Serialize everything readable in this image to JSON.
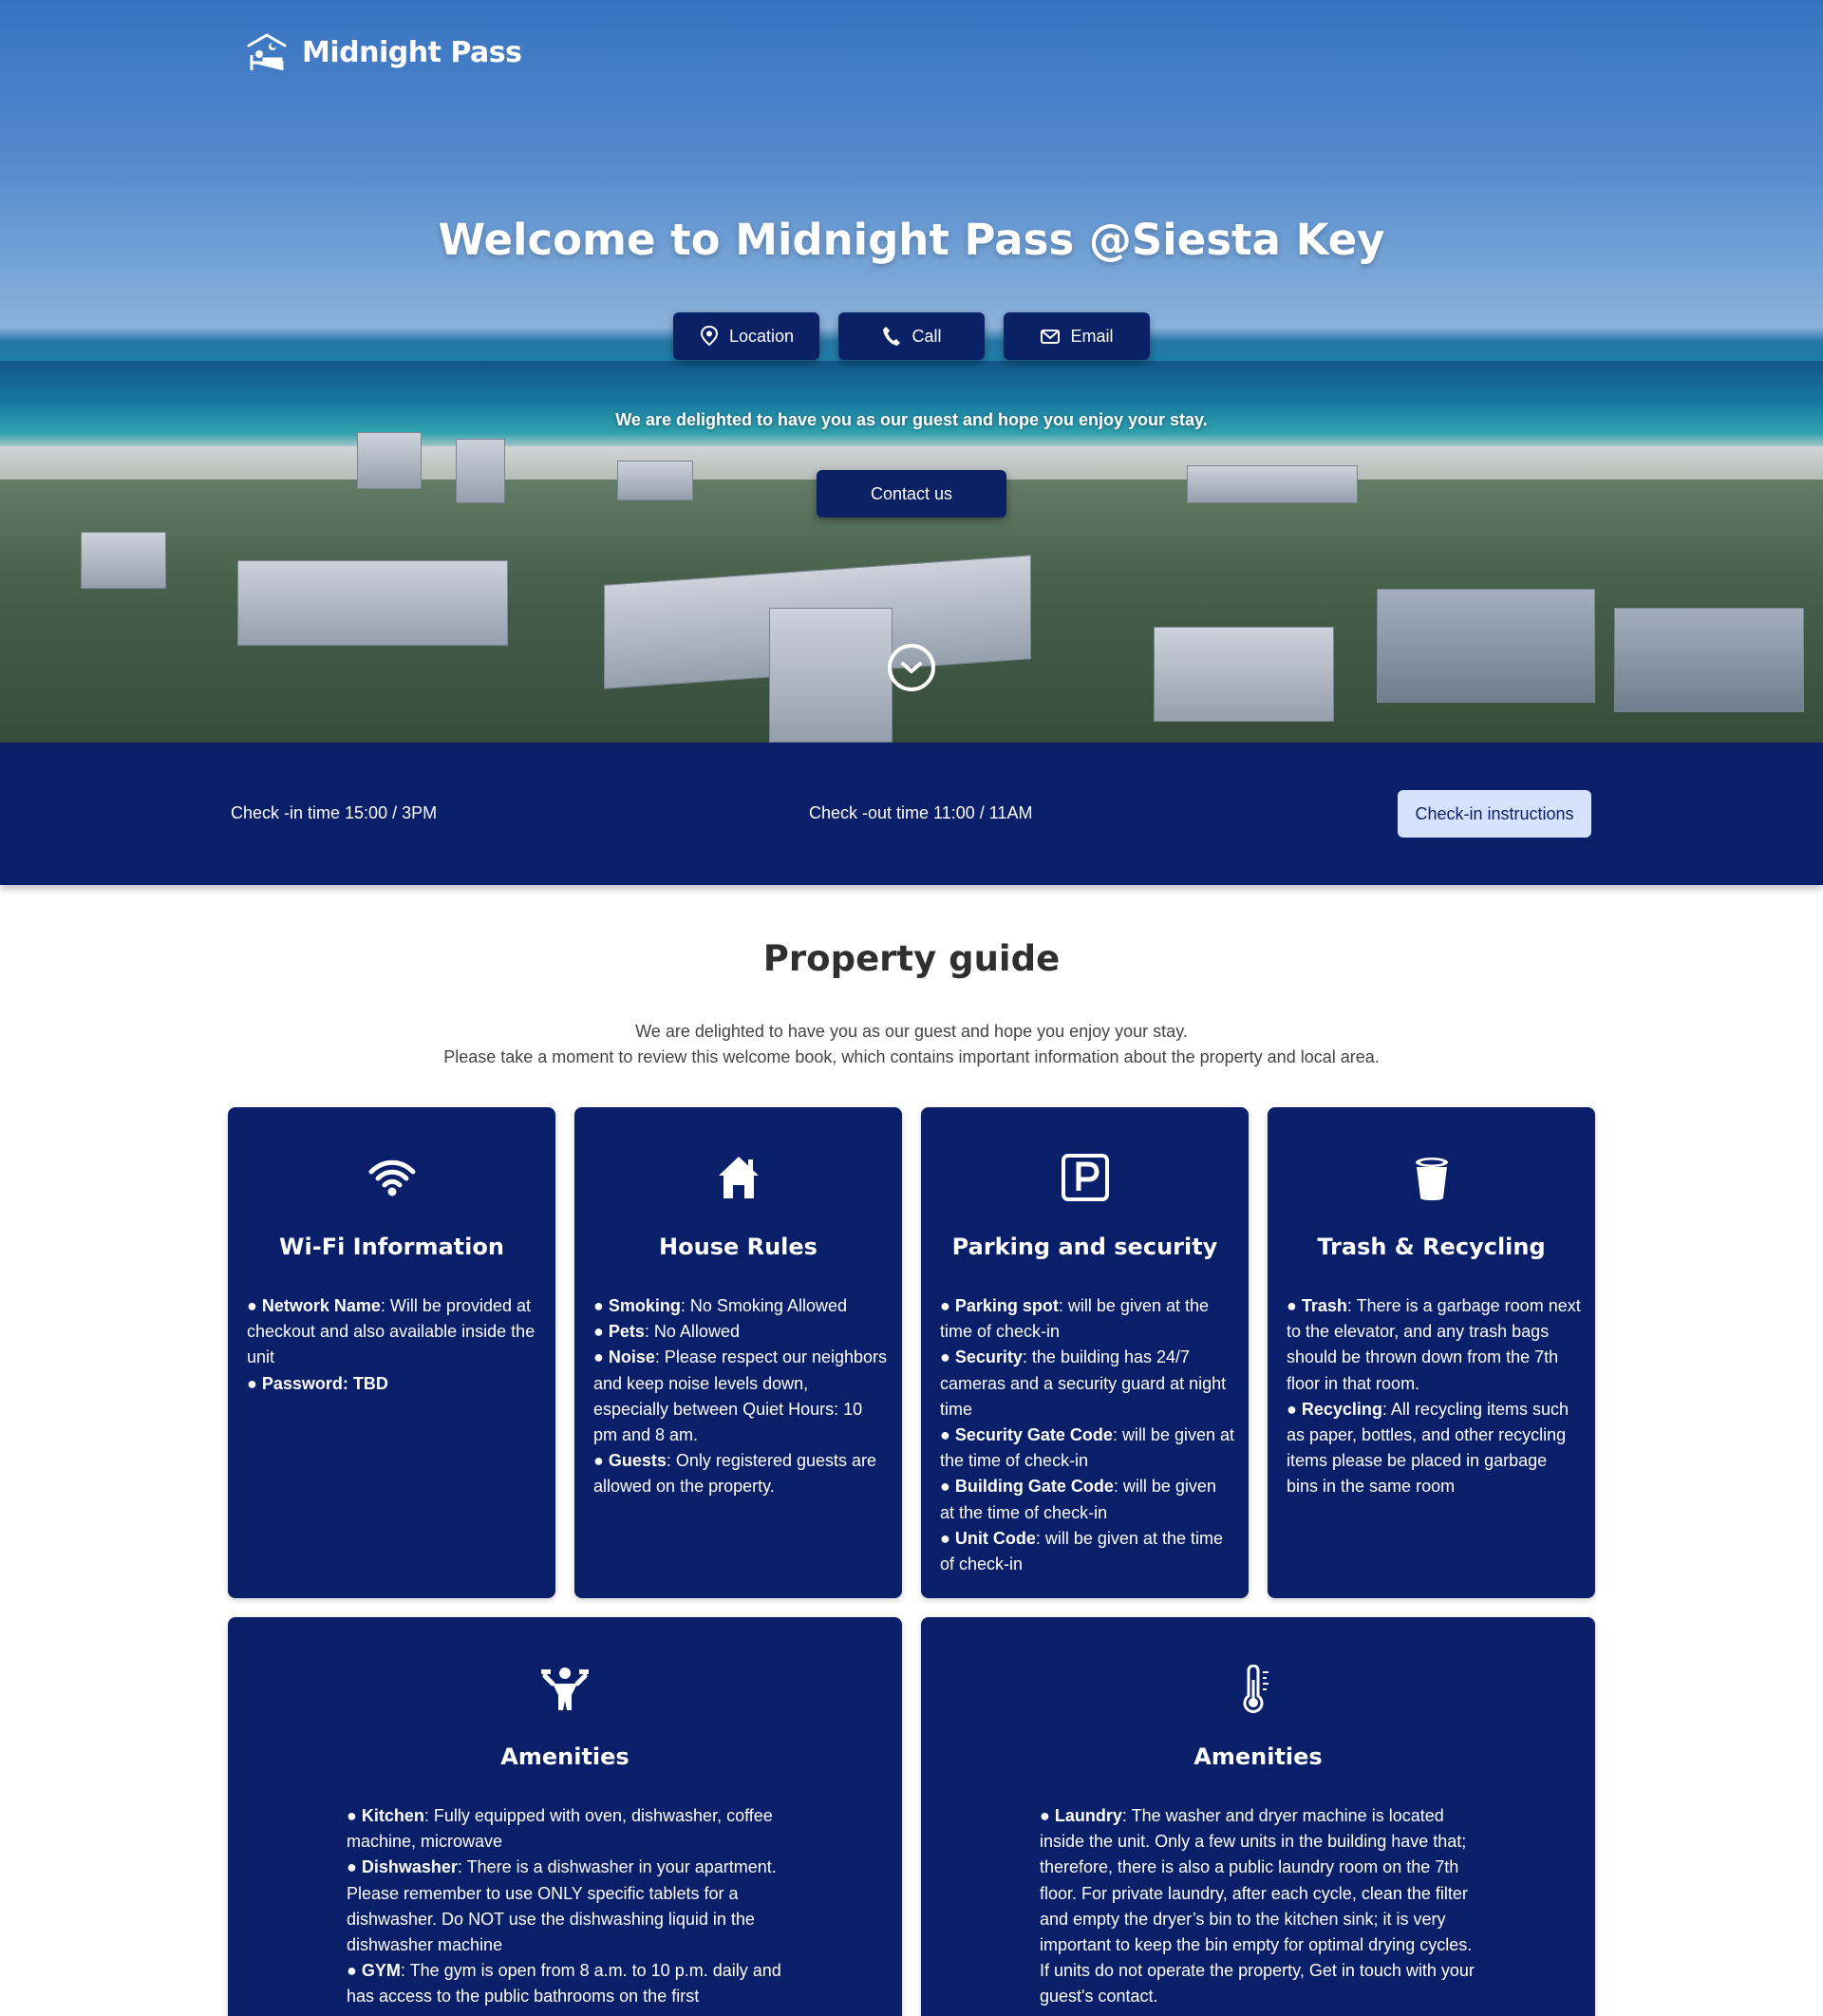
{
  "brand": {
    "name": "Midnight Pass"
  },
  "hero": {
    "title": "Welcome to Midnight Pass @Siesta Key",
    "buttons": [
      {
        "label": "Location",
        "icon": "map-pin-icon"
      },
      {
        "label": "Call",
        "icon": "phone-icon"
      },
      {
        "label": "Email",
        "icon": "mail-icon"
      }
    ],
    "subtitle": "We are delighted to have you as our guest and hope you enjoy your stay.",
    "contact_label": "Contact us"
  },
  "checkbar": {
    "checkin": "Check -in time 15:00 / 3PM",
    "checkout": "Check -out time 11:00 / 11AM",
    "instructions_label": "Check-in instructions"
  },
  "guide": {
    "title": "Property guide",
    "intro_line1": "We are delighted to have you as our guest and hope you enjoy your stay.",
    "intro_line2": "Please take a moment to review this welcome book, which contains important information about the property and local area.",
    "cards": [
      {
        "title": "Wi-Fi Information",
        "icon": "wifi-icon",
        "items": [
          {
            "key": "Network Name",
            "text": ": Will be provided at checkout and also available inside the unit"
          },
          {
            "key": "Password: TBD",
            "text": ""
          }
        ]
      },
      {
        "title": "House Rules",
        "icon": "house-icon",
        "items": [
          {
            "key": "Smoking",
            "text": ": No Smoking Allowed"
          },
          {
            "key": "Pets",
            "text": ": No Allowed"
          },
          {
            "key": "Noise",
            "text": ": Please respect our neighbors and keep noise levels down, especially between Quiet Hours: 10 pm and 8 am."
          },
          {
            "key": "Guests",
            "text": ": Only registered guests are allowed on the property."
          }
        ]
      },
      {
        "title": "Parking and security",
        "icon": "parking-icon",
        "items": [
          {
            "key": "Parking spot",
            "text": ": will be given at the time of check-in"
          },
          {
            "key": "Security",
            "text": ": the building has 24/7 cameras and a security guard at night time"
          },
          {
            "key": "Security Gate Code",
            "text": ": will be given at the time of check-in"
          },
          {
            "key": "Building Gate Code",
            "text": ": will be given at the time of check-in"
          },
          {
            "key": "Unit Code",
            "text": ": will be given at the time of check-in"
          }
        ]
      },
      {
        "title": "Trash & Recycling",
        "icon": "trash-bin-icon",
        "items": [
          {
            "key": "Trash",
            "text": ": There is a garbage room next to the elevator, and any trash bags should be thrown down from the 7th floor in that room."
          },
          {
            "key": "Recycling",
            "text": ": All recycling items such as paper, bottles, and other recycling items please be placed in garbage bins in the same room"
          }
        ]
      },
      {
        "title": "Amenities",
        "icon": "gym-person-icon",
        "items": [
          {
            "key": "Kitchen",
            "text": ": Fully equipped with oven, dishwasher, coffee machine, microwave"
          },
          {
            "key": "Dishwasher",
            "text": ": There is a dishwasher in your apartment. Please remember to use ONLY specific tablets for a dishwasher. Do NOT use the dishwashing liquid in the dishwasher machine"
          },
          {
            "key": "GYM",
            "text": ": The gym is open from 8 a.m. to 10 p.m. daily and has access to the public bathrooms on the first"
          }
        ]
      },
      {
        "title": "Amenities",
        "icon": "thermometer-icon",
        "items": [
          {
            "key": "Laundry",
            "text": ": The washer and dryer machine is located inside the unit. Only a few units in the building have that; therefore, there is also a public laundry room on the 7th floor. For private laundry, after each cycle, clean the filter and empty the dryer’s bin to the kitchen sink; it is very important to keep the bin empty for optimal drying cycles. If units do not operate the property, Get in touch with your guest's contact."
          }
        ]
      }
    ]
  }
}
